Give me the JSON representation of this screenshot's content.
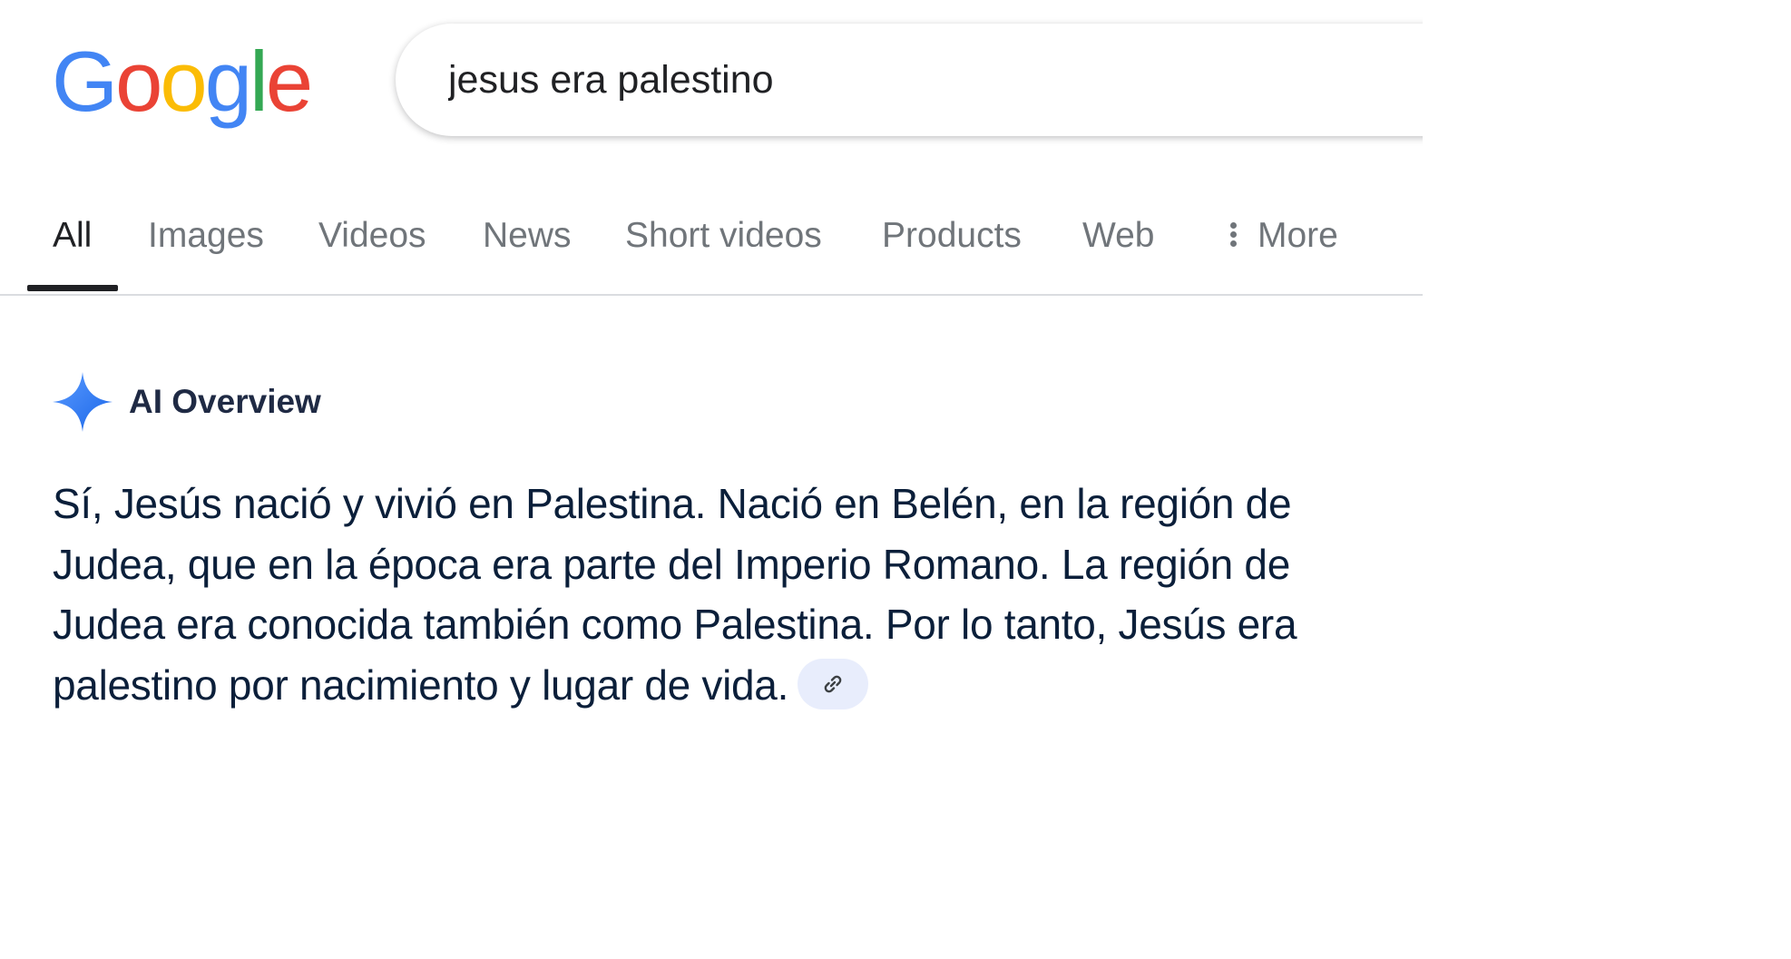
{
  "logo": {
    "text": "Google",
    "letters": [
      {
        "ch": "G",
        "color": "#4285F4"
      },
      {
        "ch": "o",
        "color": "#EA4335"
      },
      {
        "ch": "o",
        "color": "#FBBC05"
      },
      {
        "ch": "g",
        "color": "#4285F4"
      },
      {
        "ch": "l",
        "color": "#34A853"
      },
      {
        "ch": "e",
        "color": "#EA4335"
      }
    ]
  },
  "search": {
    "query": "jesus era palestino"
  },
  "tabs": {
    "items": [
      {
        "label": "All",
        "active": true
      },
      {
        "label": "Images"
      },
      {
        "label": "Videos"
      },
      {
        "label": "News"
      },
      {
        "label": "Short videos"
      },
      {
        "label": "Products"
      },
      {
        "label": "Web"
      }
    ],
    "more_label": "More"
  },
  "ai_overview": {
    "title": "AI Overview",
    "icon": "sparkle-icon",
    "accent_color": "#4285F4",
    "text": "Sí, Jesús nació y vivió en Palestina. Nació en Belén, en la región de Judea, que en la época era parte del Imperio Romano. La región de Judea era conocida también como Palestina. Por lo tanto, Jesús era palestino por nacimiento y lugar de vida.",
    "link_icon": "link-icon"
  }
}
